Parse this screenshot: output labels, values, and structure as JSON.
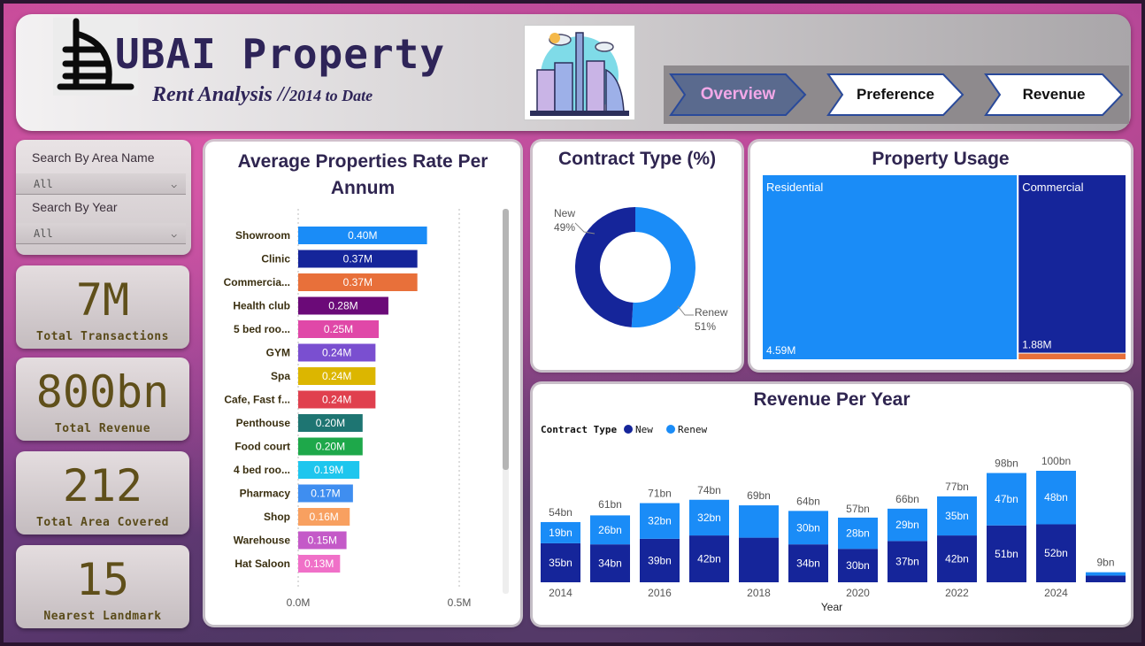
{
  "header": {
    "title": "UBAI Property",
    "subtitle_main": "Rent Analysis //",
    "subtitle_small": "2014 to Date"
  },
  "nav": [
    {
      "label": "Overview",
      "active": true
    },
    {
      "label": "Preference",
      "active": false
    },
    {
      "label": "Revenue",
      "active": false
    }
  ],
  "filters": {
    "area_label": "Search By Area Name",
    "area_value": "All",
    "year_label": "Search By Year",
    "year_value": "All"
  },
  "kpis": [
    {
      "value": "7M",
      "label": "Total Transactions"
    },
    {
      "value": "800bn",
      "label": "Total Revenue"
    },
    {
      "value": "212",
      "label": "Total Area Covered"
    },
    {
      "value": "15",
      "label": "Nearest Landmark"
    }
  ],
  "colors": {
    "navy": "#15259a",
    "blue": "#1a8cf7",
    "orange": "#e8703a",
    "title": "#2f2550"
  },
  "chart_data": [
    {
      "type": "bar",
      "orientation": "horizontal",
      "title": "Average Properties Rate Per Annum",
      "categories": [
        "Showroom",
        "Clinic",
        "Commercia...",
        "Health club",
        "5 bed roo...",
        "GYM",
        "Spa",
        "Cafe, Fast f...",
        "Penthouse",
        "Food court",
        "4 bed roo...",
        "Pharmacy",
        "Shop",
        "Warehouse",
        "Hat Saloon"
      ],
      "values": [
        0.4,
        0.37,
        0.37,
        0.28,
        0.25,
        0.24,
        0.24,
        0.24,
        0.2,
        0.2,
        0.19,
        0.17,
        0.16,
        0.15,
        0.13
      ],
      "value_labels": [
        "0.40M",
        "0.37M",
        "0.37M",
        "0.28M",
        "0.25M",
        "0.24M",
        "0.24M",
        "0.24M",
        "0.20M",
        "0.20M",
        "0.19M",
        "0.17M",
        "0.16M",
        "0.15M",
        "0.13M"
      ],
      "bar_colors": [
        "#1a8cf7",
        "#15259a",
        "#e8703a",
        "#6b0a78",
        "#e048a8",
        "#7a4fd0",
        "#dcb600",
        "#e0404e",
        "#1e7572",
        "#1ea84a",
        "#1ec6ee",
        "#3f8ef0",
        "#f8a060",
        "#c45ac8",
        "#f070c8"
      ],
      "xlim": [
        0,
        0.5
      ],
      "x_ticks": [
        "0.0M",
        "0.5M"
      ],
      "grid": true
    },
    {
      "type": "pie",
      "donut": true,
      "title": "Contract Type (%)",
      "slices": [
        {
          "label": "New",
          "value": 49,
          "pct_label": "49%",
          "color": "#15259a"
        },
        {
          "label": "Renew",
          "value": 51,
          "pct_label": "51%",
          "color": "#1a8cf7"
        }
      ]
    },
    {
      "type": "treemap",
      "title": "Property Usage",
      "items": [
        {
          "label": "Residential",
          "value": 4.59,
          "value_label": "4.59M",
          "color": "#1a8cf7"
        },
        {
          "label": "Commercial",
          "value": 1.88,
          "value_label": "1.88M",
          "color": "#15259a"
        },
        {
          "label": "",
          "value": 0.06,
          "value_label": "",
          "color": "#e8703a"
        }
      ]
    },
    {
      "type": "bar",
      "stacked": true,
      "title": "Revenue Per Year",
      "legend_title": "Contract Type",
      "legend_position": "top-left",
      "xlabel": "Year",
      "categories": [
        2014,
        2015,
        2016,
        2017,
        2018,
        2019,
        2020,
        2021,
        2022,
        2023,
        2024,
        2025
      ],
      "x_tick_labels": [
        "2014",
        "2016",
        "2018",
        "2020",
        "2022",
        "2024"
      ],
      "series": [
        {
          "name": "New",
          "color": "#15259a",
          "values": [
            35,
            34,
            39,
            42,
            40,
            34,
            30,
            37,
            42,
            51,
            52,
            6
          ],
          "labels": [
            "35bn",
            "34bn",
            "39bn",
            "42bn",
            "",
            "34bn",
            "30bn",
            "37bn",
            "42bn",
            "51bn",
            "52bn",
            ""
          ]
        },
        {
          "name": "Renew",
          "color": "#1a8cf7",
          "values": [
            19,
            26,
            32,
            32,
            29,
            30,
            28,
            29,
            35,
            47,
            48,
            3
          ],
          "labels": [
            "19bn",
            "26bn",
            "32bn",
            "32bn",
            "",
            "30bn",
            "28bn",
            "29bn",
            "35bn",
            "47bn",
            "48bn",
            ""
          ]
        }
      ],
      "totals": [
        "54bn",
        "61bn",
        "71bn",
        "74bn",
        "69bn",
        "64bn",
        "57bn",
        "66bn",
        "77bn",
        "98bn",
        "100bn",
        "9bn"
      ],
      "total_values": [
        54,
        61,
        71,
        74,
        69,
        64,
        57,
        66,
        77,
        98,
        100,
        9
      ],
      "ylim": [
        0,
        100
      ],
      "grid": false
    }
  ]
}
